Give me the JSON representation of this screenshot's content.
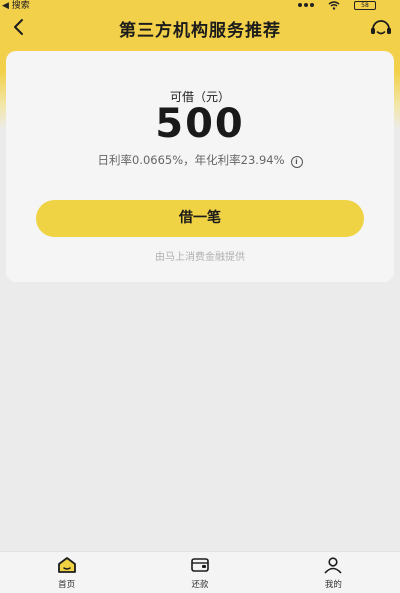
{
  "status_bar": {
    "back_label": "◀ 搜索",
    "battery": "58"
  },
  "nav": {
    "title": "第三方机构服务推荐",
    "back_icon": "chevron-left-icon",
    "service_icon": "customer-service-headset-icon"
  },
  "loan_card": {
    "label": "可借（元）",
    "amount": "500",
    "rates": "日利率0.0665%，年化利率23.94%",
    "info_icon": "info-icon",
    "button_label": "借一笔",
    "provider_text": "由马上消费金融提供"
  },
  "tabs": [
    {
      "label": "首页",
      "icon": "home-icon",
      "active": true
    },
    {
      "label": "还款",
      "icon": "wallet-icon",
      "active": false
    },
    {
      "label": "我的",
      "icon": "user-icon",
      "active": false
    }
  ],
  "colors": {
    "accent": "#f0d245",
    "header": "#f2d04a",
    "background": "#ebebeb"
  }
}
